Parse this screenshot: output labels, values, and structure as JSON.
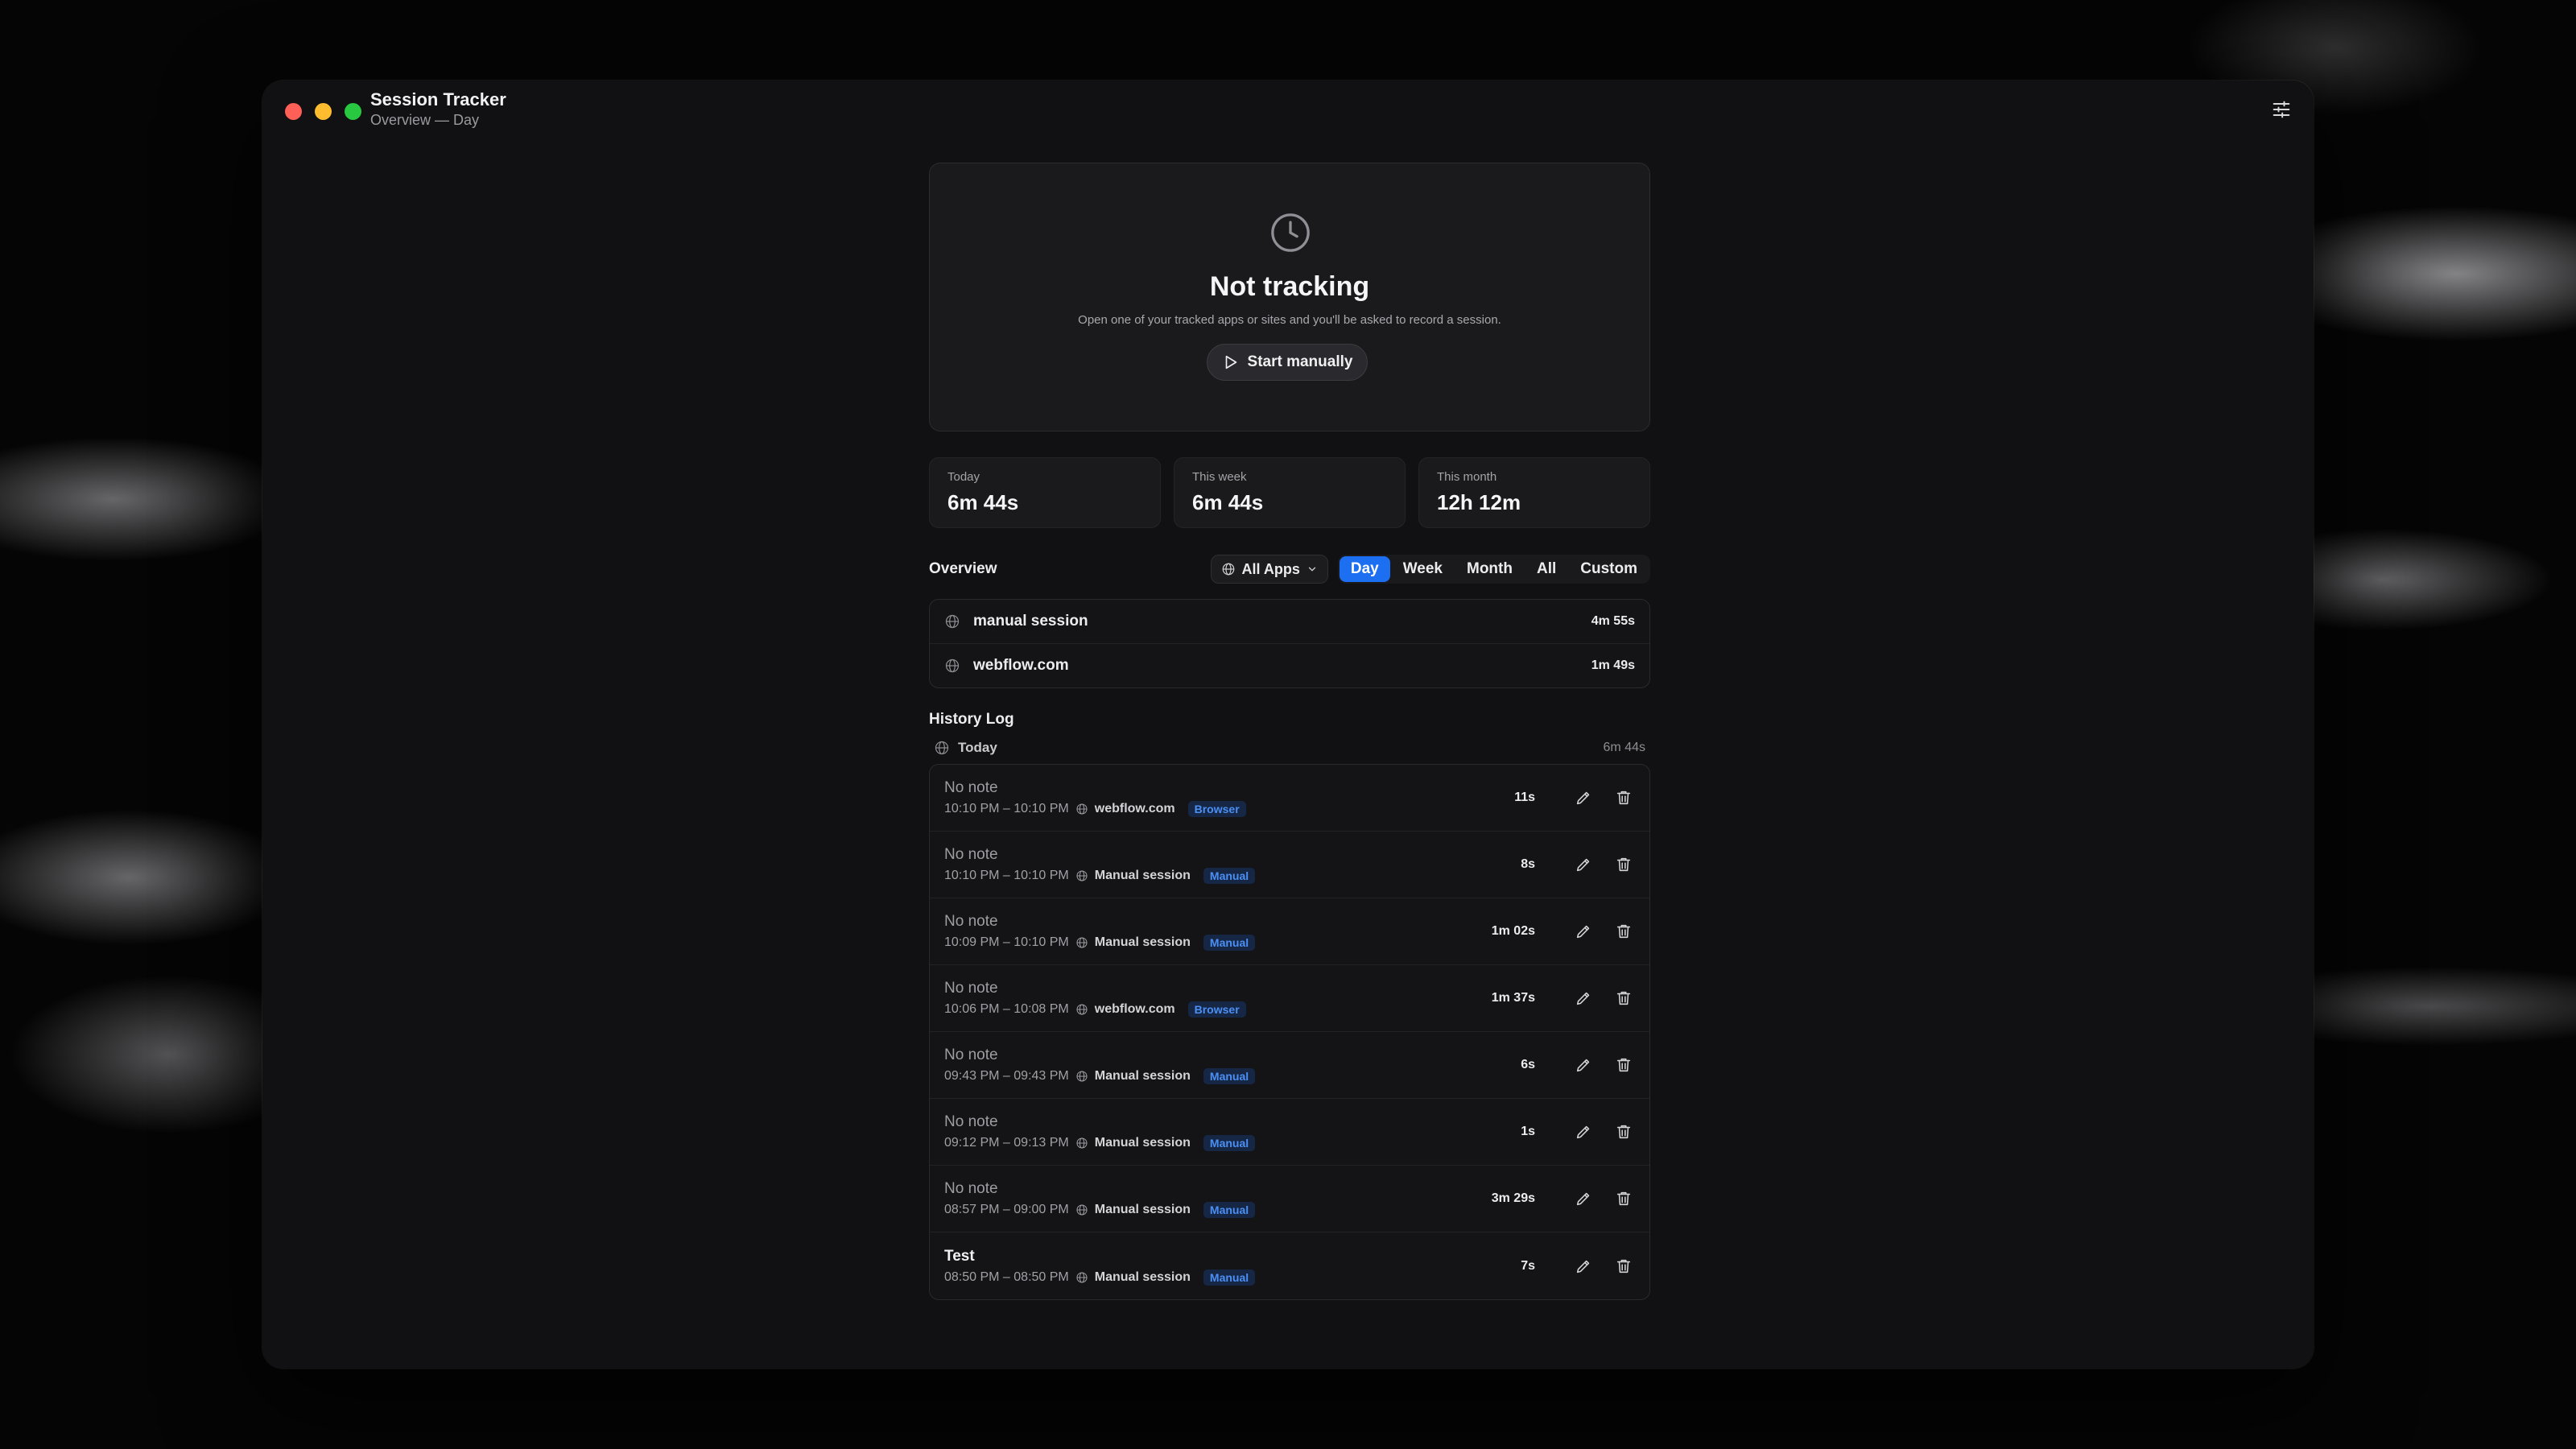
{
  "window": {
    "title": "Session Tracker",
    "subtitle": "Overview — Day",
    "controls": [
      "close",
      "minimize",
      "zoom"
    ],
    "settings_icon": "sliders-icon"
  },
  "status_card": {
    "icon": "clock-icon",
    "title": "Not tracking",
    "description": "Open one of your tracked apps or sites and you'll be asked to record a session.",
    "start_button": "Start manually"
  },
  "stats": [
    {
      "label": "Today",
      "value": "6m 44s"
    },
    {
      "label": "This week",
      "value": "6m 44s"
    },
    {
      "label": "This month",
      "value": "12h 12m"
    }
  ],
  "overview": {
    "title": "Overview",
    "app_filter": "All Apps",
    "ranges": [
      "Day",
      "Week",
      "Month",
      "All",
      "Custom"
    ],
    "active_range": "Day",
    "apps": [
      {
        "name": "manual session",
        "duration": "4m 55s"
      },
      {
        "name": "webflow.com",
        "duration": "1m 49s"
      }
    ]
  },
  "history": {
    "title": "History Log",
    "day_label": "Today",
    "day_total": "6m 44s",
    "entries": [
      {
        "note": "No note",
        "time": "10:10 PM – 10:10 PM",
        "source": "webflow.com",
        "badge": "Browser",
        "duration": "11s"
      },
      {
        "note": "No note",
        "time": "10:10 PM – 10:10 PM",
        "source": "Manual session",
        "badge": "Manual",
        "duration": "8s"
      },
      {
        "note": "No note",
        "time": "10:09 PM – 10:10 PM",
        "source": "Manual session",
        "badge": "Manual",
        "duration": "1m 02s"
      },
      {
        "note": "No note",
        "time": "10:06 PM – 10:08 PM",
        "source": "webflow.com",
        "badge": "Browser",
        "duration": "1m 37s"
      },
      {
        "note": "No note",
        "time": "09:43 PM – 09:43 PM",
        "source": "Manual session",
        "badge": "Manual",
        "duration": "6s"
      },
      {
        "note": "No note",
        "time": "09:12 PM – 09:13 PM",
        "source": "Manual session",
        "badge": "Manual",
        "duration": "1s"
      },
      {
        "note": "No note",
        "time": "08:57 PM – 09:00 PM",
        "source": "Manual session",
        "badge": "Manual",
        "duration": "3m 29s"
      },
      {
        "note": "Test",
        "time": "08:50 PM – 08:50 PM",
        "source": "Manual session",
        "badge": "Manual",
        "duration": "7s"
      }
    ]
  },
  "colors": {
    "accent": "#1d6ff2",
    "badge_text": "#4b8ff5",
    "close": "#fe5f57",
    "minimize": "#febc2e",
    "zoom": "#28c840"
  }
}
